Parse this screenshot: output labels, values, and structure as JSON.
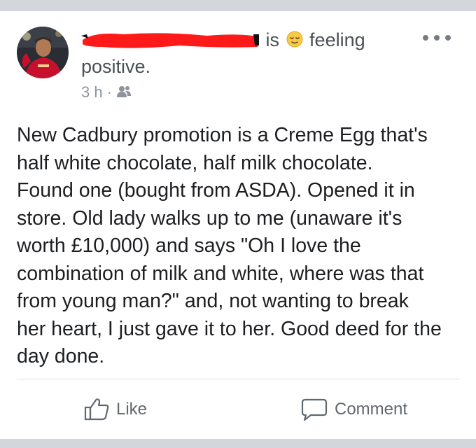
{
  "post": {
    "header": {
      "author_name": "",
      "verb": "is",
      "feeling_text": "feeling",
      "feeling_continuation": "positive.",
      "feeling_emoji": "relieved-face-icon"
    },
    "meta": {
      "timestamp": "3 h",
      "separator": "·",
      "audience_icon": "friends-icon"
    },
    "body": "New Cadbury promotion is a Creme Egg that's\nhalf white chocolate, half milk chocolate.\nFound one (bought from ASDA). Opened it in\nstore. Old lady walks up to me (unaware it's\nworth £10,000) and says \"Oh I love the\ncombination of milk and white, where was that\nfrom young man?\" and, not wanting to break\nher heart, I just gave it to her. Good deed for the\nday done.",
    "actions": {
      "like_label": "Like",
      "comment_label": "Comment"
    }
  },
  "colors": {
    "background": "#d3d6db",
    "card": "#ffffff",
    "redaction": "#ff1a1a",
    "text_primary": "#1c1e21",
    "text_secondary": "#606770"
  }
}
